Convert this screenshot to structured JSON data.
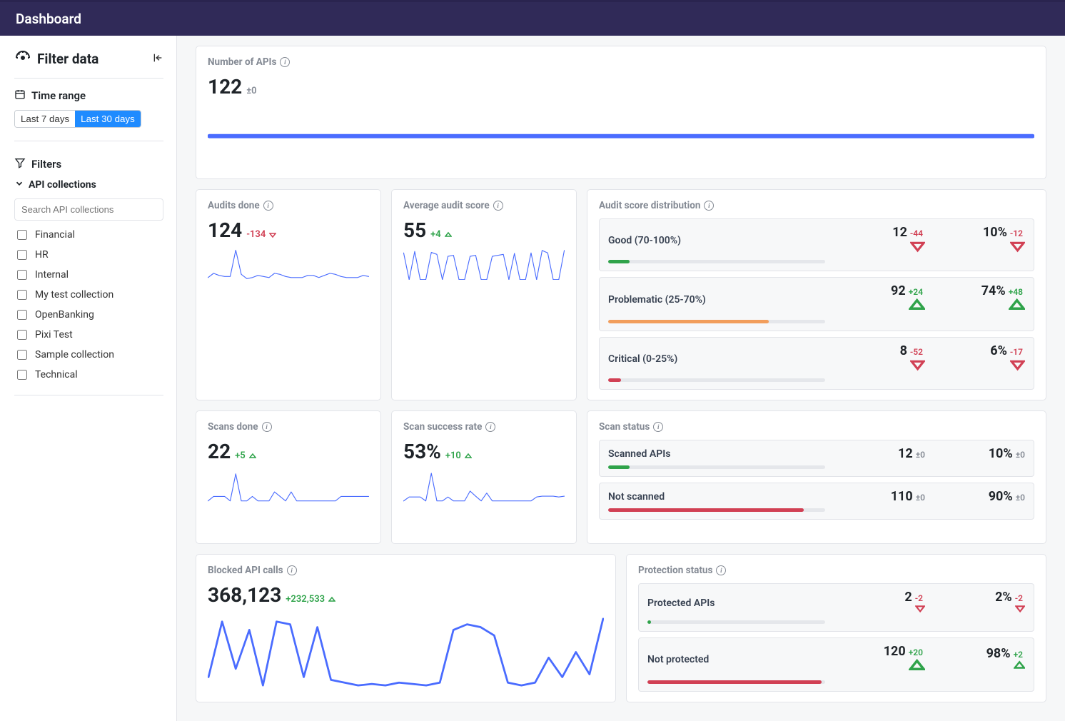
{
  "header": {
    "title": "Dashboard"
  },
  "sidebar": {
    "title": "Filter data",
    "time_range_label": "Time range",
    "time_range_options": [
      "Last 7 days",
      "Last 30 days"
    ],
    "time_range_selected": "Last 30 days",
    "filters_label": "Filters",
    "api_collections_label": "API collections",
    "search_placeholder": "Search API collections",
    "collections": [
      {
        "label": "Financial",
        "checked": false
      },
      {
        "label": "HR",
        "checked": false
      },
      {
        "label": "Internal",
        "checked": false
      },
      {
        "label": "My test collection",
        "checked": false
      },
      {
        "label": "OpenBanking",
        "checked": false
      },
      {
        "label": "Pixi Test",
        "checked": false
      },
      {
        "label": "Sample collection",
        "checked": false
      },
      {
        "label": "Technical",
        "checked": false
      }
    ]
  },
  "cards": {
    "num_apis": {
      "title": "Number of APIs",
      "value": "122",
      "delta": "±0",
      "delta_dir": "zero"
    },
    "audits": {
      "title": "Audits done",
      "value": "124",
      "delta": "-134",
      "delta_dir": "neg"
    },
    "avg_score": {
      "title": "Average audit score",
      "value": "55",
      "delta": "+4",
      "delta_dir": "pos"
    },
    "scans": {
      "title": "Scans done",
      "value": "22",
      "delta": "+5",
      "delta_dir": "pos"
    },
    "scan_rate": {
      "title": "Scan success rate",
      "value": "53%",
      "delta": "+10",
      "delta_dir": "pos"
    },
    "blocked": {
      "title": "Blocked API calls",
      "value": "368,123",
      "delta": "+232,533",
      "delta_dir": "pos"
    },
    "audit_dist": {
      "title": "Audit score distribution",
      "rows": [
        {
          "label": "Good (70-100%)",
          "color": "#2fa34a",
          "fill": 10,
          "val": "12",
          "vdelta": "-44",
          "vdir": "neg",
          "pct": "10%",
          "pdelta": "-12",
          "pdir": "neg"
        },
        {
          "label": "Problematic (25-70%)",
          "color": "#f29e5c",
          "fill": 74,
          "val": "92",
          "vdelta": "+24",
          "vdir": "pos",
          "pct": "74%",
          "pdelta": "+48",
          "pdir": "pos"
        },
        {
          "label": "Critical (0-25%)",
          "color": "#d14054",
          "fill": 6,
          "val": "8",
          "vdelta": "-52",
          "vdir": "neg",
          "pct": "6%",
          "pdelta": "-17",
          "pdir": "neg"
        }
      ]
    },
    "scan_status": {
      "title": "Scan status",
      "rows": [
        {
          "label": "Scanned APIs",
          "color": "#2fa34a",
          "fill": 10,
          "val": "12",
          "vdelta": "±0",
          "vdir": "zero",
          "pct": "10%",
          "pdelta": "±0",
          "pdir": "zero"
        },
        {
          "label": "Not scanned",
          "color": "#d14054",
          "fill": 90,
          "val": "110",
          "vdelta": "±0",
          "vdir": "zero",
          "pct": "90%",
          "pdelta": "±0",
          "pdir": "zero"
        }
      ]
    },
    "protection": {
      "title": "Protection status",
      "rows": [
        {
          "label": "Protected APIs",
          "color": "#2fa34a",
          "fill": 2,
          "val": "2",
          "vdelta": "-2",
          "vdir": "neg",
          "pct": "2%",
          "pdelta": "-2",
          "pdir": "neg"
        },
        {
          "label": "Not protected",
          "color": "#d14054",
          "fill": 98,
          "val": "120",
          "vdelta": "+20",
          "vdir": "pos",
          "pct": "98%",
          "pdelta": "+2",
          "pdir": "pos"
        }
      ]
    }
  },
  "chart_data": [
    {
      "id": "num_apis",
      "type": "line",
      "title": "Number of APIs",
      "y": [
        122,
        122,
        122,
        122,
        122,
        122,
        122,
        122,
        122,
        122,
        122,
        122,
        122,
        122,
        122,
        122,
        122,
        122,
        122,
        122,
        122,
        122,
        122,
        122,
        122,
        122,
        122,
        122,
        122,
        122
      ],
      "ylim": [
        0,
        150
      ]
    },
    {
      "id": "audits",
      "type": "line",
      "title": "Audits done",
      "y": [
        2,
        6,
        4,
        3,
        3,
        28,
        5,
        1,
        2,
        4,
        3,
        2,
        6,
        5,
        3,
        2,
        2,
        2,
        4,
        4,
        2,
        4,
        6,
        5,
        3,
        2,
        2,
        2,
        4,
        3
      ],
      "ylim": [
        0,
        30
      ]
    },
    {
      "id": "avg_score",
      "type": "line",
      "title": "Average audit score",
      "y": [
        55,
        0,
        58,
        0,
        0,
        56,
        52,
        0,
        48,
        50,
        0,
        0,
        48,
        50,
        0,
        0,
        48,
        50,
        52,
        0,
        54,
        0,
        0,
        55,
        0,
        60,
        55,
        0,
        0,
        60
      ],
      "ylim": [
        0,
        65
      ]
    },
    {
      "id": "scans",
      "type": "line",
      "title": "Scans done",
      "y": [
        0,
        1,
        1,
        1,
        0,
        6,
        0,
        0,
        1,
        0,
        0,
        0,
        2,
        1,
        0,
        2,
        0,
        0,
        0,
        0,
        0,
        0,
        0,
        0,
        1,
        1,
        1,
        1,
        1,
        1
      ],
      "ylim": [
        0,
        7
      ]
    },
    {
      "id": "scan_rate",
      "type": "line",
      "title": "Scan success rate (%)",
      "y": [
        0,
        10,
        10,
        10,
        0,
        70,
        0,
        0,
        10,
        0,
        0,
        0,
        25,
        12,
        0,
        20,
        0,
        0,
        0,
        0,
        0,
        0,
        0,
        0,
        10,
        12,
        12,
        12,
        10,
        12
      ],
      "ylim": [
        0,
        80
      ]
    },
    {
      "id": "blocked",
      "type": "line",
      "title": "Blocked API calls",
      "y": [
        5000,
        25000,
        8000,
        22000,
        2000,
        25000,
        24000,
        5000,
        23000,
        4000,
        3000,
        2000,
        2500,
        2000,
        3000,
        2500,
        2000,
        3000,
        22000,
        24000,
        23000,
        20000,
        3000,
        2000,
        3000,
        12000,
        5000,
        14000,
        6000,
        26000
      ],
      "ylim": [
        0,
        28000
      ]
    }
  ]
}
